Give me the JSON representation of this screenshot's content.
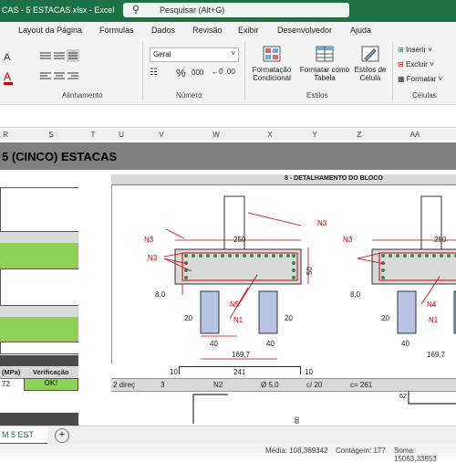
{
  "titlebar": {
    "file_title": "CAS - 5 ESTACAS.xlsx  -  Excel",
    "search_placeholder": "Pesquisar (Alt+G)"
  },
  "menu_tabs": [
    "Layout da Página",
    "Fórmulas",
    "Dados",
    "Revisão",
    "Exibir",
    "Desenvolvedor",
    "Ajuda"
  ],
  "ribbon": {
    "font_name": "Geral",
    "groups": {
      "alignment": "Alinhamento",
      "number": "Número",
      "styles": "Estilos",
      "cells": "Células"
    },
    "buttons": {
      "cond_format_1": "Formatação",
      "cond_format_2": "Condicional",
      "format_table_1": "Formatar como",
      "format_table_2": "Tabela",
      "cell_styles_1": "Estilos de",
      "cell_styles_2": "Célula",
      "insert": "Inserir",
      "delete": "Excluir",
      "format": "Formatar"
    },
    "percent": "%",
    "thousands": "000"
  },
  "columns": [
    "R",
    "S",
    "T",
    "U",
    "V",
    "W",
    "X",
    "Y",
    "Z",
    "AA"
  ],
  "sheet": {
    "title": "5 (CINCO) ESTACAS",
    "detail_header": "8 - DETALHAMENTO DO BLOCO",
    "left_table": {
      "col1": "(MPa)",
      "col2": "Verificação",
      "val1": "72",
      "val2": "OK!"
    },
    "bottom_row": {
      "c1": "2 direç",
      "c2": "3",
      "c3": "N2",
      "c4": "Ø 5,0",
      "c5": "c/ 20",
      "c6": "c= 261"
    },
    "drawing_labels": {
      "n3_a": "N3",
      "n3_b": "N3",
      "n3_c": "N3",
      "n5": "N5",
      "n1": "N1",
      "n4": "N4",
      "n1_b": "N1",
      "d250": "250",
      "d250b": "250",
      "d50": "50",
      "d8": "8,0",
      "d8b": "8,0",
      "d20": "20",
      "d20b": "20",
      "d20c": "20",
      "d40": "40",
      "d40b": "40",
      "d169": "169,7",
      "d169b": "169,7",
      "d10a": "10",
      "d241": "241",
      "d10b": "10",
      "d62": "62",
      "d60": "60"
    }
  },
  "sheet_tab": "M 5 EST",
  "status": {
    "media": "Média: 108,369342",
    "contagem": "Contagem: 177",
    "soma": "Soma: 15063,33853"
  }
}
